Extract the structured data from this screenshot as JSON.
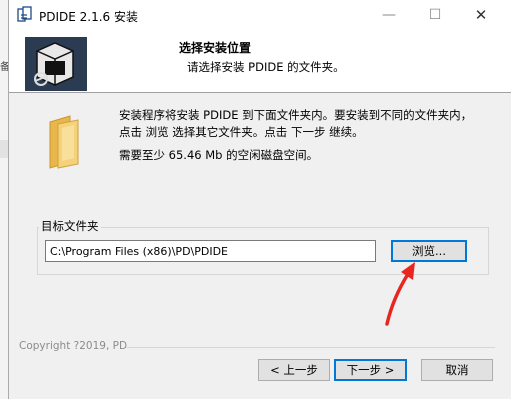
{
  "background": {
    "left_fragment": "备"
  },
  "window": {
    "title": "PDIDE 2.1.6 安装",
    "minimize_glyph": "—",
    "maximize_glyph": "☐",
    "close_glyph": "✕"
  },
  "header": {
    "title": "选择安装位置",
    "subtitle": "请选择安装 PDIDE 的文件夹。"
  },
  "body": {
    "description_line1": "安装程序将安装 PDIDE 到下面文件夹内。要安装到不同的文件夹内，",
    "description_line2": "点击 浏览 选择其它文件夹。点击 下一步 继续。",
    "space_required": "需要至少 65.46 Mb 的空闲磁盘空间。"
  },
  "destination": {
    "label": "目标文件夹",
    "path": "C:\\Program Files (x86)\\PD\\PDIDE",
    "browse_label": "浏览..."
  },
  "footer": {
    "copyright": "Copyright ?2019, PD",
    "back_label": "< 上一步",
    "next_label": "下一步 >",
    "cancel_label": "取消"
  },
  "colors": {
    "accent": "#0078d7",
    "arrow": "#e8251f",
    "header_logo_bg": "#2b3c52",
    "folder": "#f2c55c"
  }
}
